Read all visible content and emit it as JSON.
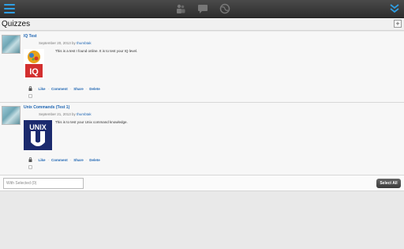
{
  "header": {
    "title": "Quizzes",
    "add_label": "+"
  },
  "items": [
    {
      "title": "IQ Test",
      "date": "September 20, 2013 by",
      "author": "thumbtak",
      "description": "This is a test I found online. It is to test your IQ level.",
      "thumb_text": "IQ",
      "actions": {
        "like": "Like",
        "comment": "Comment",
        "share": "Share",
        "delete": "Delete"
      }
    },
    {
      "title": "Unix Commands (Test 1)",
      "date": "September 21, 2013 by",
      "author": "thumbtak",
      "description": "This is to test your Unix command knowledge.",
      "thumb_text": "UNIX",
      "actions": {
        "like": "Like",
        "comment": "Comment",
        "share": "Share",
        "delete": "Delete"
      }
    }
  ],
  "footer": {
    "with_selected": "With Selected (0)",
    "select_all": "Select All"
  },
  "colors": {
    "accent": "#2f9ee3",
    "link": "#1f66b3"
  }
}
